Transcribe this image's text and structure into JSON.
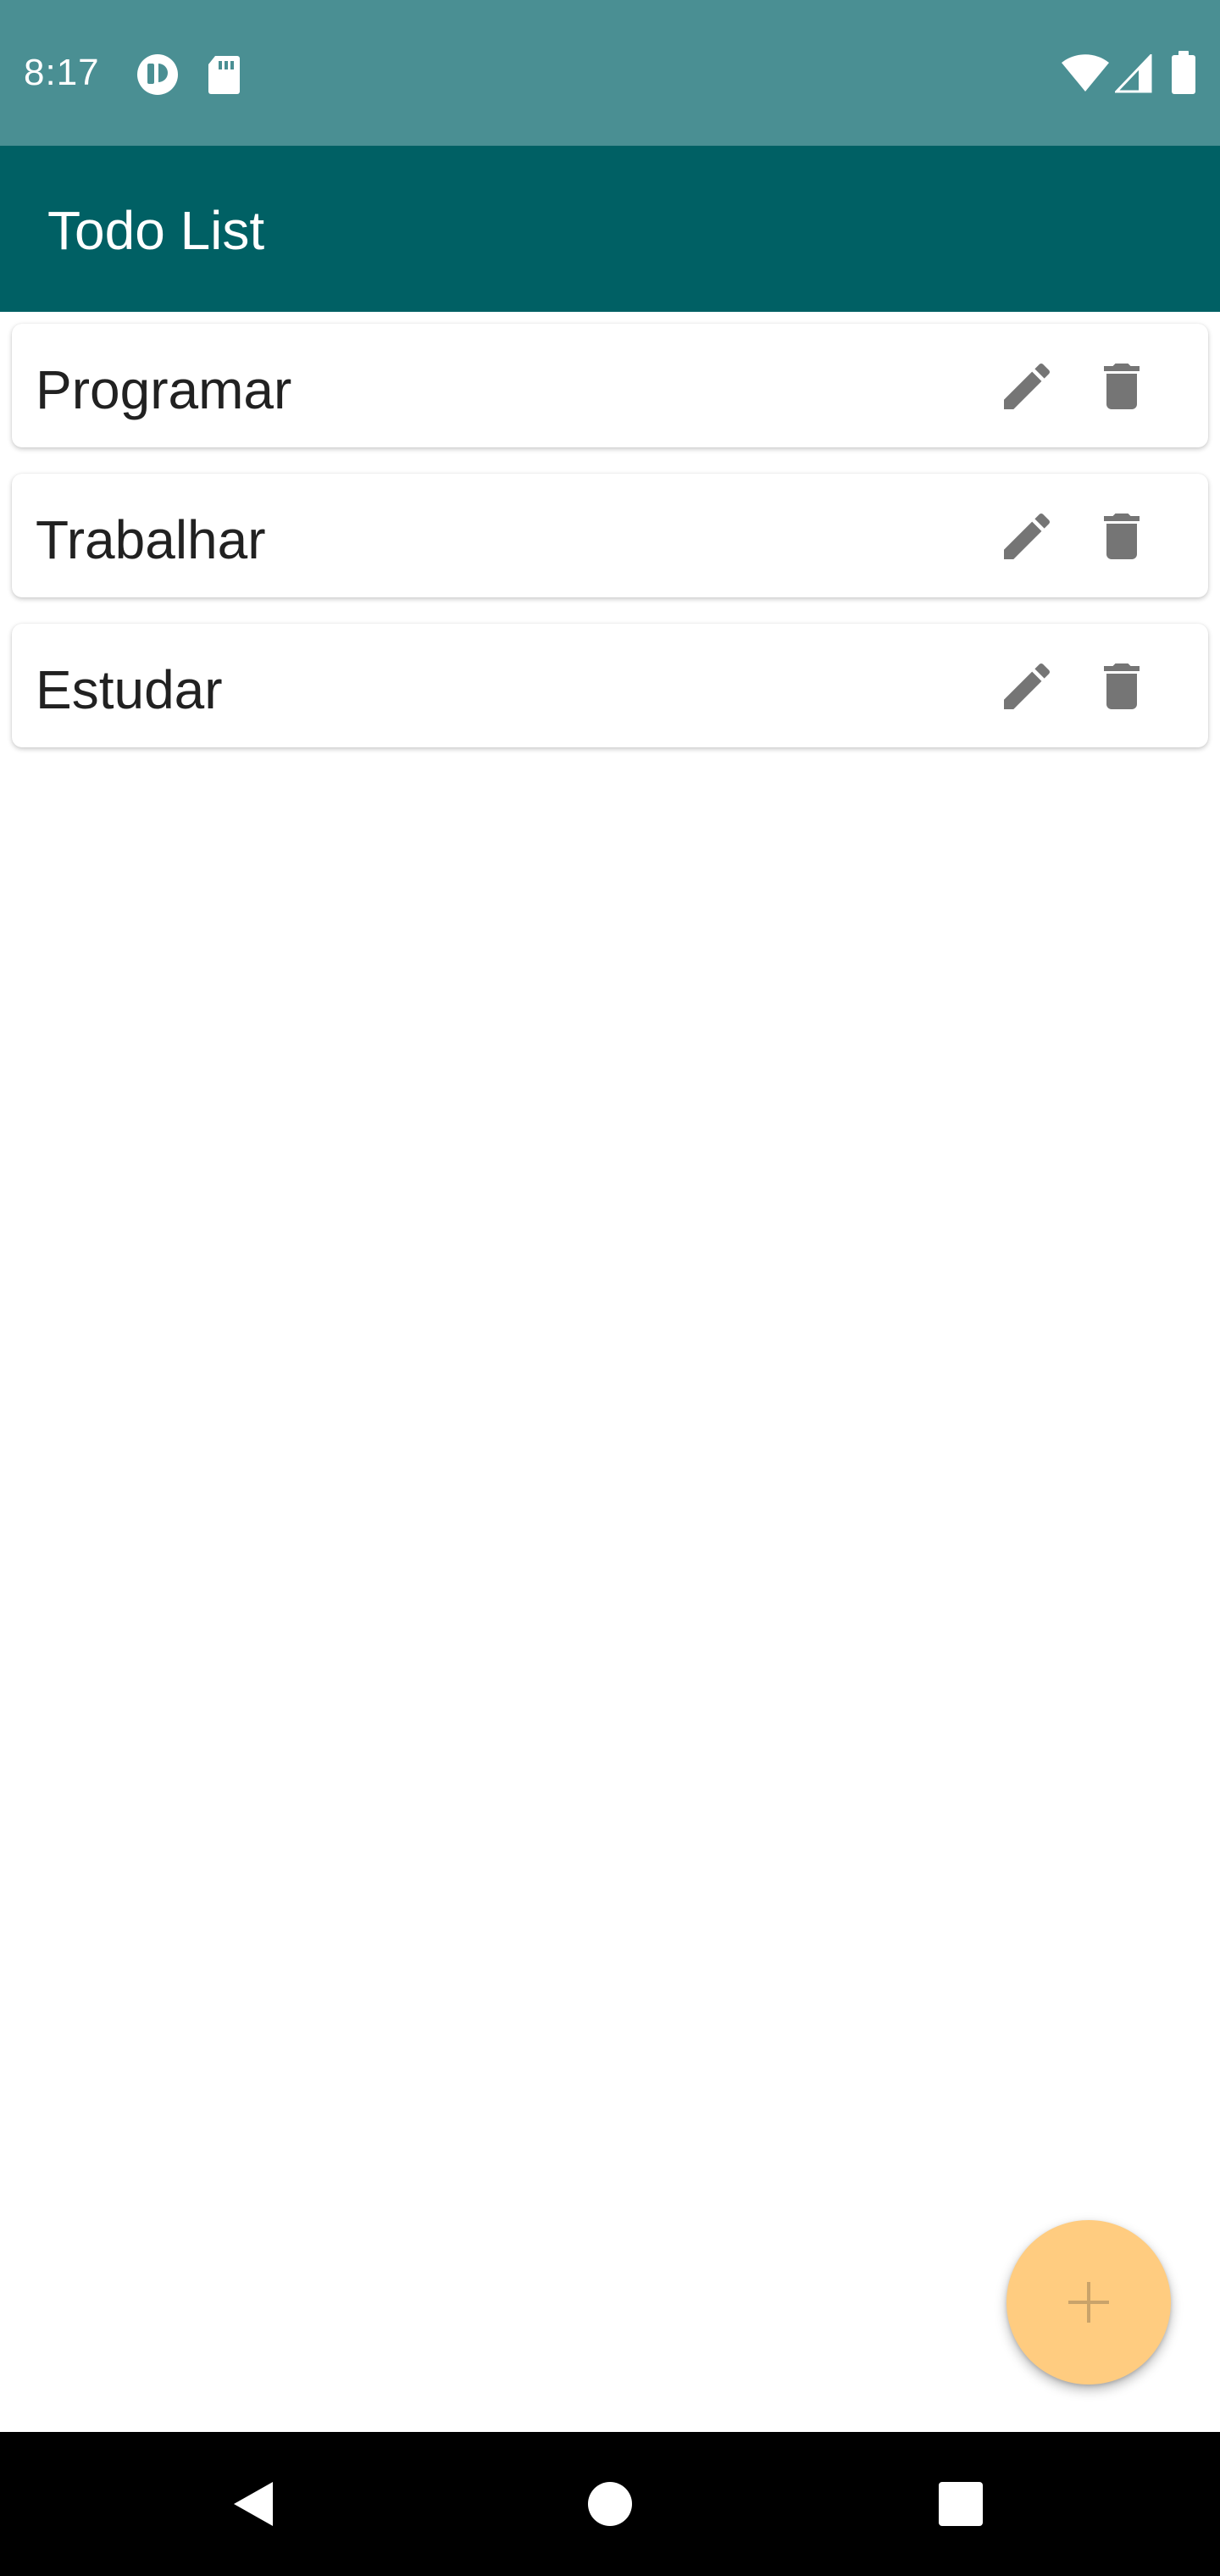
{
  "status_bar": {
    "time": "8:17",
    "background": "#4a8f93",
    "left_icons": [
      "notification-app-icon",
      "sd-card-icon"
    ],
    "right_icons": [
      "wifi-icon",
      "cell-signal-icon",
      "battery-icon"
    ]
  },
  "app_bar": {
    "title": "Todo List",
    "background": "#006064"
  },
  "todos": [
    {
      "label": "Programar"
    },
    {
      "label": "Trabalhar"
    },
    {
      "label": "Estudar"
    }
  ],
  "item_actions": {
    "edit_icon": "pencil-icon",
    "delete_icon": "trash-icon",
    "icon_color": "#757575"
  },
  "fab": {
    "icon": "plus-icon",
    "background": "#ffcc80",
    "icon_color": "#c9a36a"
  },
  "nav_bar": {
    "buttons": [
      "back-icon",
      "home-icon",
      "recents-icon"
    ]
  }
}
